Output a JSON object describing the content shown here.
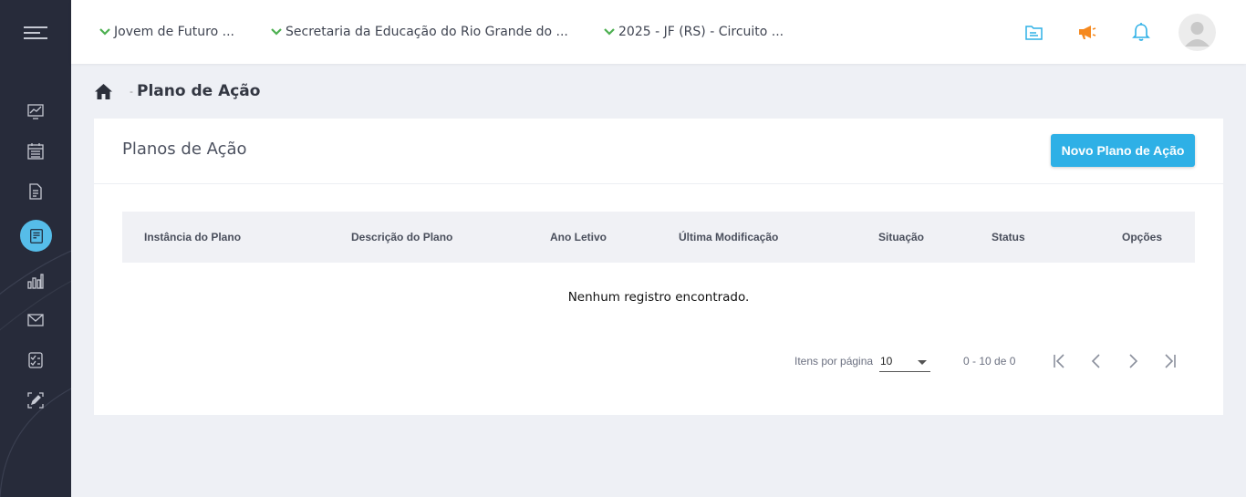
{
  "sidebar": {
    "items": [
      {
        "icon": "chart-line-icon"
      },
      {
        "icon": "calendar-icon"
      },
      {
        "icon": "document-icon"
      },
      {
        "icon": "action-plan-icon",
        "active": true
      },
      {
        "icon": "bar-chart-icon"
      },
      {
        "icon": "mail-icon"
      },
      {
        "icon": "checklist-icon"
      },
      {
        "icon": "edit-icon"
      }
    ],
    "active_color": "#56bde9",
    "background": "#272b3a"
  },
  "topbar": {
    "selectors": [
      {
        "label": "Jovem de Futuro ..."
      },
      {
        "label": "Secretaria da Educação do Rio Grande do ..."
      },
      {
        "label": "2025 - JF (RS) - Circuito ..."
      }
    ],
    "chevron_color": "#4caf50",
    "icons": [
      "folder-icon",
      "megaphone-icon",
      "bell-icon",
      "avatar"
    ]
  },
  "breadcrumb": {
    "separator": "-",
    "current": "Plano de Ação"
  },
  "card": {
    "title": "Planos de Ação",
    "new_button_label": "Novo Plano de Ação",
    "table": {
      "columns": [
        "Instância do Plano",
        "Descrição do Plano",
        "Ano Letivo",
        "Última Modificação",
        "Situação",
        "Status",
        "Opções"
      ],
      "rows": [],
      "empty_message": "Nenhum registro encontrado."
    },
    "paginator": {
      "items_per_page_label": "Itens por página",
      "items_per_page": "10",
      "range_label": "0 - 10 de 0"
    }
  },
  "colors": {
    "accent": "#2eb0e6",
    "megaphone": "#f5891f",
    "chevron": "#4caf50"
  }
}
